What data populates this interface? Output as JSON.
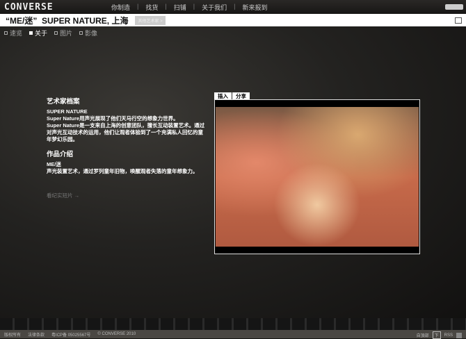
{
  "brand": "CONVERSE",
  "nav": [
    "你制造",
    "找货",
    "扫铺",
    "关于我们",
    "新来报到"
  ],
  "header": {
    "title": "“ME/迷”  SUPER NATURE, 上海",
    "other_button": "其他艺术家 >"
  },
  "subnav": [
    {
      "label": "速览",
      "active": false
    },
    {
      "label": "关于",
      "active": true
    },
    {
      "label": "图片",
      "active": false
    },
    {
      "label": "影像",
      "active": false
    }
  ],
  "info": {
    "profile_heading": "艺术家档案",
    "artist": "SUPER NATURE",
    "bio1": "Super Nature用声光展现了他们天马行空的想象力世界。",
    "bio2": "Super Nature是一支来自上海的创意团队，擅长互动装置艺术。通过对声光互动技术的运用，他们让观者体验到了一个充满私人回忆的童年梦幻乐园。",
    "work_heading": "作品介绍",
    "work_title": "ME/迷",
    "work_desc": "声光装置艺术，通过罗列童年旧物，唤醒观者失落的童年想象力。",
    "more_link": "看纪实短片 →"
  },
  "video_tabs": [
    "插入",
    "分享"
  ],
  "footer": {
    "links": [
      "版权所有",
      "法律条款",
      "粤ICP备 05025567号",
      "© CONVERSE 2010"
    ],
    "subscribe": "自頂部",
    "subscribe_btn": "下",
    "rss": "RSS"
  }
}
